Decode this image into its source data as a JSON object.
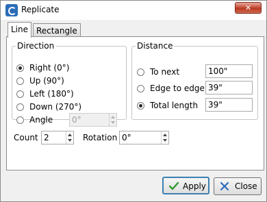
{
  "window": {
    "title": "Replicate",
    "close_symbol": "✕"
  },
  "tabs": [
    {
      "label": "Line",
      "active": true
    },
    {
      "label": "Rectangle",
      "active": false
    }
  ],
  "direction": {
    "legend": "Direction",
    "options": [
      {
        "label": "Right (0°)",
        "selected": true
      },
      {
        "label": "Up (90°)",
        "selected": false
      },
      {
        "label": "Left (180°)",
        "selected": false
      },
      {
        "label": "Down (270°)",
        "selected": false
      },
      {
        "label": "Angle",
        "selected": false
      }
    ],
    "angle_value": "0°"
  },
  "distance": {
    "legend": "Distance",
    "options": [
      {
        "label": "To next",
        "value": "100\"",
        "selected": false
      },
      {
        "label": "Edge to edge",
        "value": "39\"",
        "selected": false
      },
      {
        "label": "Total length",
        "value": "39\"",
        "selected": true
      }
    ]
  },
  "count": {
    "label": "Count",
    "value": "2"
  },
  "rotation": {
    "label": "Rotation",
    "value": "0°"
  },
  "buttons": {
    "apply": "Apply",
    "close": "Close"
  },
  "colors": {
    "apply_check": "#2f9a2f",
    "close_x": "#2b6cb8",
    "default_border": "#3c7fb1"
  }
}
